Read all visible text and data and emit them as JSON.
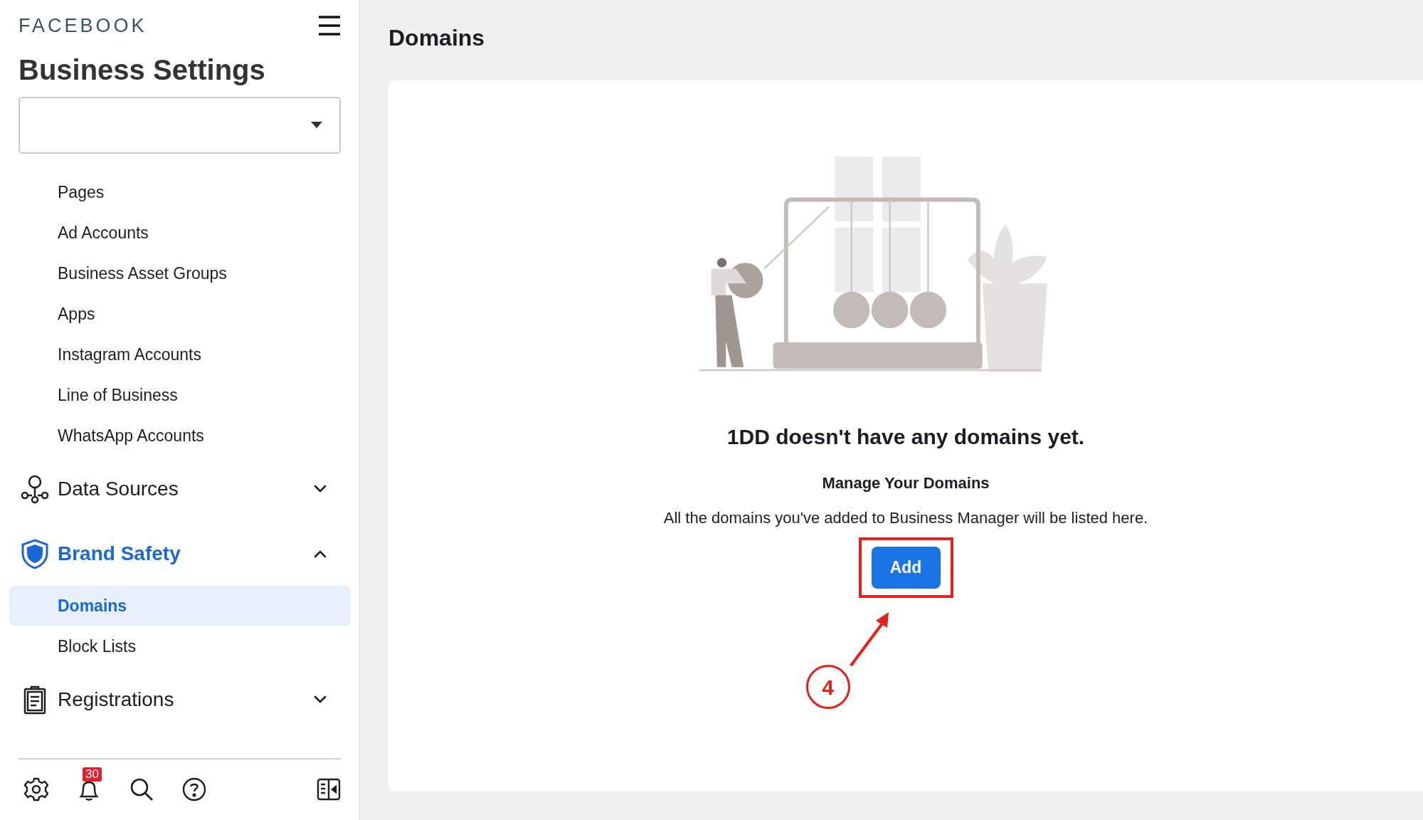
{
  "sidebar": {
    "brand": "FACEBOOK",
    "title": "Business Settings",
    "nav": [
      {
        "kind": "item",
        "label": "Pages",
        "selected": false
      },
      {
        "kind": "item",
        "label": "Ad Accounts",
        "selected": false
      },
      {
        "kind": "item",
        "label": "Business Asset Groups",
        "selected": false
      },
      {
        "kind": "item",
        "label": "Apps",
        "selected": false
      },
      {
        "kind": "item",
        "label": "Instagram Accounts",
        "selected": false
      },
      {
        "kind": "item",
        "label": "Line of Business",
        "selected": false
      },
      {
        "kind": "item",
        "label": "WhatsApp Accounts",
        "selected": false
      },
      {
        "kind": "group",
        "label": "Data Sources",
        "selected": false,
        "expanded": false
      },
      {
        "kind": "group",
        "label": "Brand Safety",
        "selected": true,
        "expanded": true,
        "children": [
          {
            "label": "Domains",
            "selected": true
          },
          {
            "label": "Block Lists",
            "selected": false
          }
        ]
      },
      {
        "kind": "group",
        "label": "Registrations",
        "selected": false,
        "expanded": false
      }
    ],
    "notification_count": "30"
  },
  "page": {
    "title": "Domains",
    "heading": "1DD doesn't have any domains yet.",
    "subheading": "Manage Your Domains",
    "description": "All the domains you've added to Business Manager will be listed here.",
    "add_button": "Add"
  },
  "annotation": {
    "step": "4"
  }
}
